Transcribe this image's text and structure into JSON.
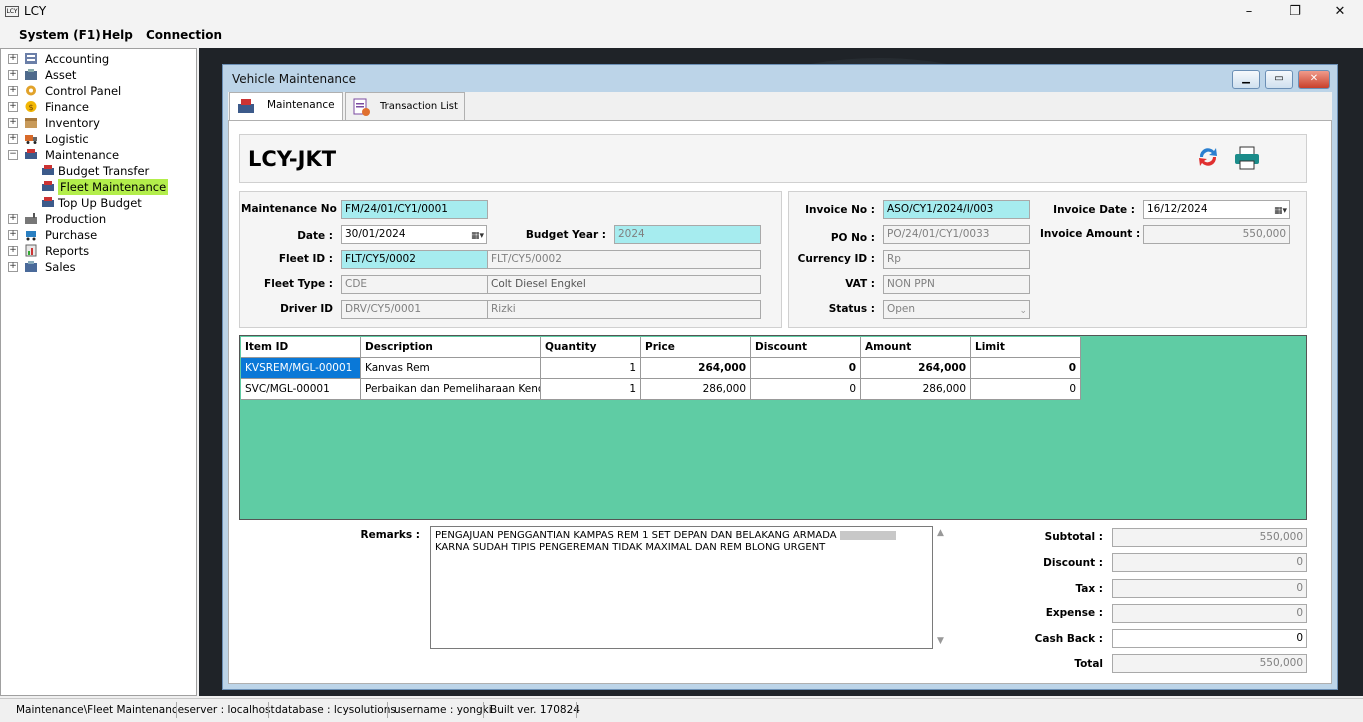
{
  "app": {
    "title": "LCY",
    "icon": "app-icon",
    "window_controls": {
      "minimize": "–",
      "maximize": "❐",
      "close": "✕"
    }
  },
  "menu": {
    "items": [
      "System (F1)",
      "Help",
      "Connection"
    ]
  },
  "tree": {
    "items": [
      {
        "label": "Accounting",
        "icon": "ledger-icon"
      },
      {
        "label": "Asset",
        "icon": "asset-icon"
      },
      {
        "label": "Control Panel",
        "icon": "gear-icon"
      },
      {
        "label": "Finance",
        "icon": "coins-icon"
      },
      {
        "label": "Inventory",
        "icon": "box-icon"
      },
      {
        "label": "Logistic",
        "icon": "truck-icon"
      },
      {
        "label": "Maintenance",
        "icon": "tools-icon"
      },
      {
        "label": "Budget Transfer",
        "icon": "tools-icon"
      },
      {
        "label": "Fleet Maintenance",
        "icon": "tools-icon"
      },
      {
        "label": "Top Up Budget",
        "icon": "tools-icon"
      },
      {
        "label": "Production",
        "icon": "factory-icon"
      },
      {
        "label": "Purchase",
        "icon": "cart-icon"
      },
      {
        "label": "Reports",
        "icon": "report-icon"
      },
      {
        "label": "Sales",
        "icon": "sales-icon"
      }
    ]
  },
  "window": {
    "title": "Vehicle Maintenance",
    "tabs": [
      "Maintenance",
      "Transaction List"
    ],
    "company": "LCY-JKT"
  },
  "form": {
    "maintenance_no_label": "Maintenance No :",
    "maintenance_no": "FM/24/01/CY1/0001",
    "date_label": "Date :",
    "date": "30/01/2024",
    "budget_year_label": "Budget Year :",
    "budget_year": "2024",
    "fleet_id_label": "Fleet ID :",
    "fleet_id": "FLT/CY5/0002",
    "fleet_id_desc": "FLT/CY5/0002",
    "fleet_type_label": "Fleet Type :",
    "fleet_type": "CDE",
    "fleet_type_desc": "Colt Diesel Engkel",
    "driver_id_label": "Driver ID",
    "driver_id": "DRV/CY5/0001",
    "driver_name": "Rizki",
    "invoice_no_label": "Invoice No :",
    "invoice_no": "ASO/CY1/2024/I/003",
    "po_no_label": "PO No :",
    "po_no": "PO/24/01/CY1/0033",
    "currency_id_label": "Currency ID :",
    "currency_id": "Rp",
    "vat_label": "VAT :",
    "vat": "NON PPN",
    "status_label": "Status :",
    "status": "Open",
    "invoice_date_label": "Invoice Date :",
    "invoice_date": "16/12/2024",
    "invoice_amount_label": "Invoice Amount :",
    "invoice_amount": "550,000"
  },
  "grid": {
    "columns": [
      "Item ID",
      "Description",
      "Quantity",
      "Price",
      "Discount",
      "Amount",
      "Limit"
    ],
    "rows": [
      [
        "KVSREM/MGL-00001",
        "Kanvas Rem",
        "1",
        "264,000",
        "0",
        "264,000",
        "0"
      ],
      [
        "SVC/MGL-00001",
        "Perbaikan dan Pemeliharaan Kend...",
        "1",
        "286,000",
        "0",
        "286,000",
        "0"
      ]
    ]
  },
  "remarks": {
    "label": "Remarks :",
    "line1": "PENGAJUAN PENGGANTIAN KAMPAS REM 1 SET DEPAN DAN BELAKANG  ARMADA",
    "line2": "KARNA SUDAH TIPIS PENGEREMAN TIDAK MAXIMAL DAN REM BLONG URGENT"
  },
  "totals": {
    "subtotal_label": "Subtotal :",
    "subtotal": "550,000",
    "discount_label": "Discount :",
    "discount": "0",
    "tax_label": "Tax :",
    "tax": "0",
    "expense_label": "Expense :",
    "expense": "0",
    "cashback_label": "Cash Back :",
    "cashback": "0",
    "total_label": "Total",
    "total": "550,000"
  },
  "statusbar": {
    "path": "Maintenance\\Fleet Maintenance",
    "server": "server : localhost",
    "database": "database : lcysolutions",
    "username": "username : yongki",
    "build": "Built ver. 170824"
  },
  "colors": {
    "grid_bg": "#5fcca4",
    "selected_tree": "#b3ee4b",
    "cyan_field": "#a6ecef",
    "selected_cell": "#0a78d7"
  }
}
